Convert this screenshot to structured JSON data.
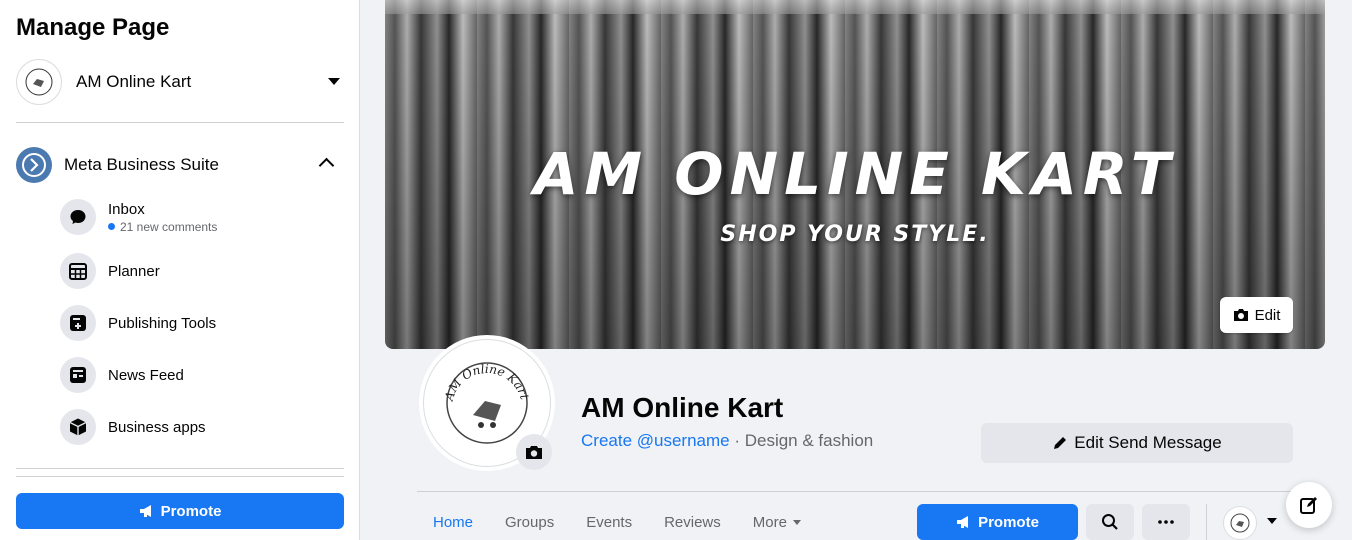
{
  "sidebar": {
    "title": "Manage Page",
    "page_name": "AM Online Kart",
    "suite_label": "Meta Business Suite",
    "items": [
      {
        "label": "Inbox",
        "sub": "21 new comments",
        "icon": "chat-bubble-icon"
      },
      {
        "label": "Planner",
        "icon": "calendar-grid-icon"
      },
      {
        "label": "Publishing Tools",
        "icon": "publishing-tools-icon"
      },
      {
        "label": "News Feed",
        "icon": "news-feed-icon"
      },
      {
        "label": "Business apps",
        "icon": "cube-icon"
      }
    ],
    "promote_label": "Promote"
  },
  "cover": {
    "title": "AM ONLINE KART",
    "subtitle": "SHOP YOUR STYLE.",
    "edit_label": "Edit"
  },
  "profile": {
    "name": "AM Online Kart",
    "username_link": "Create @username",
    "category": " · Design & fashion",
    "logo_text": "AM Online Kart"
  },
  "actions": {
    "edit_send_label": "Edit Send Message",
    "promote_label": "Promote"
  },
  "tabs": [
    "Home",
    "Groups",
    "Events",
    "Reviews",
    "More"
  ],
  "colors": {
    "accent": "#1877f2",
    "button_gray": "#e4e6eb",
    "text_secondary": "#65676b"
  }
}
